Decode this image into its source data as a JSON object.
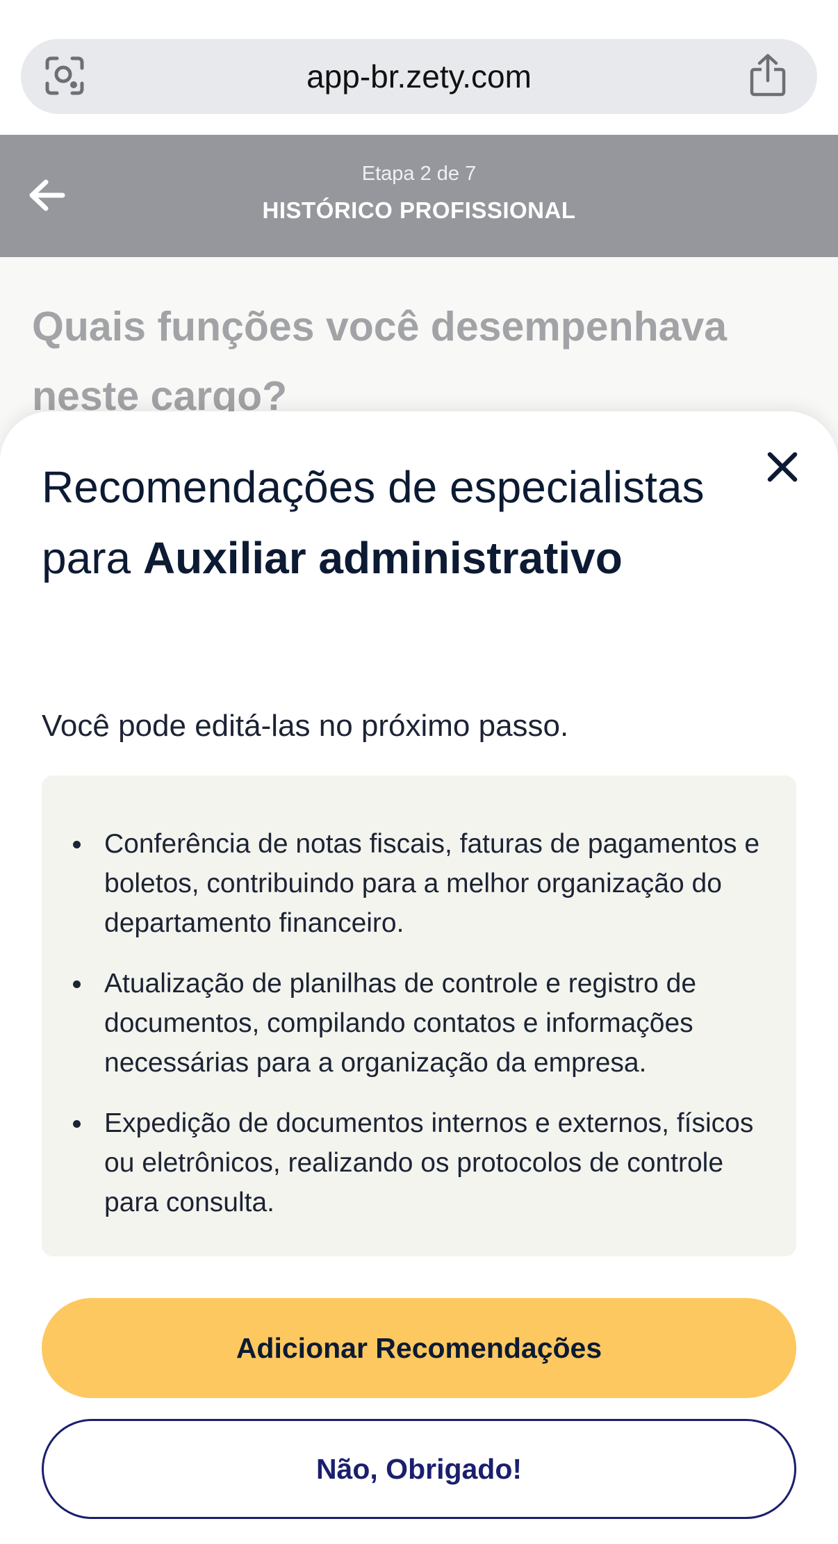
{
  "browser": {
    "url": "app-br.zety.com",
    "left_icon": "lens-icon",
    "right_icon": "share-icon"
  },
  "header": {
    "step": "Etapa 2 de 7",
    "title": "HISTÓRICO PROFISSIONAL",
    "back_icon": "arrow-left-icon",
    "background_color": "#95979c"
  },
  "background_question": "Quais funções você desempenhava neste cargo?",
  "modal": {
    "title_prefix": "Recomendações de especialistas para ",
    "title_job": "Auxiliar administrativo",
    "subtitle": "Você pode editá-las no próximo passo.",
    "close_icon": "close-icon",
    "recommendations": [
      "Conferência de notas fiscais, faturas de pagamentos e boletos, contribuindo para a melhor organização do departamento financeiro.",
      "Atualização de planilhas de controle e registro de documentos, compilando contatos e informações necessárias para a organização da empresa.",
      "Expedição de documentos internos e externos, físicos ou eletrônicos, realizando os protocolos de controle para consulta."
    ],
    "primary_button": "Adicionar Recomendações",
    "secondary_button": "Não, Obrigado!",
    "colors": {
      "primary": "#fdc860",
      "secondary_border": "#1a1f6e",
      "text": "#0c1a33"
    }
  }
}
